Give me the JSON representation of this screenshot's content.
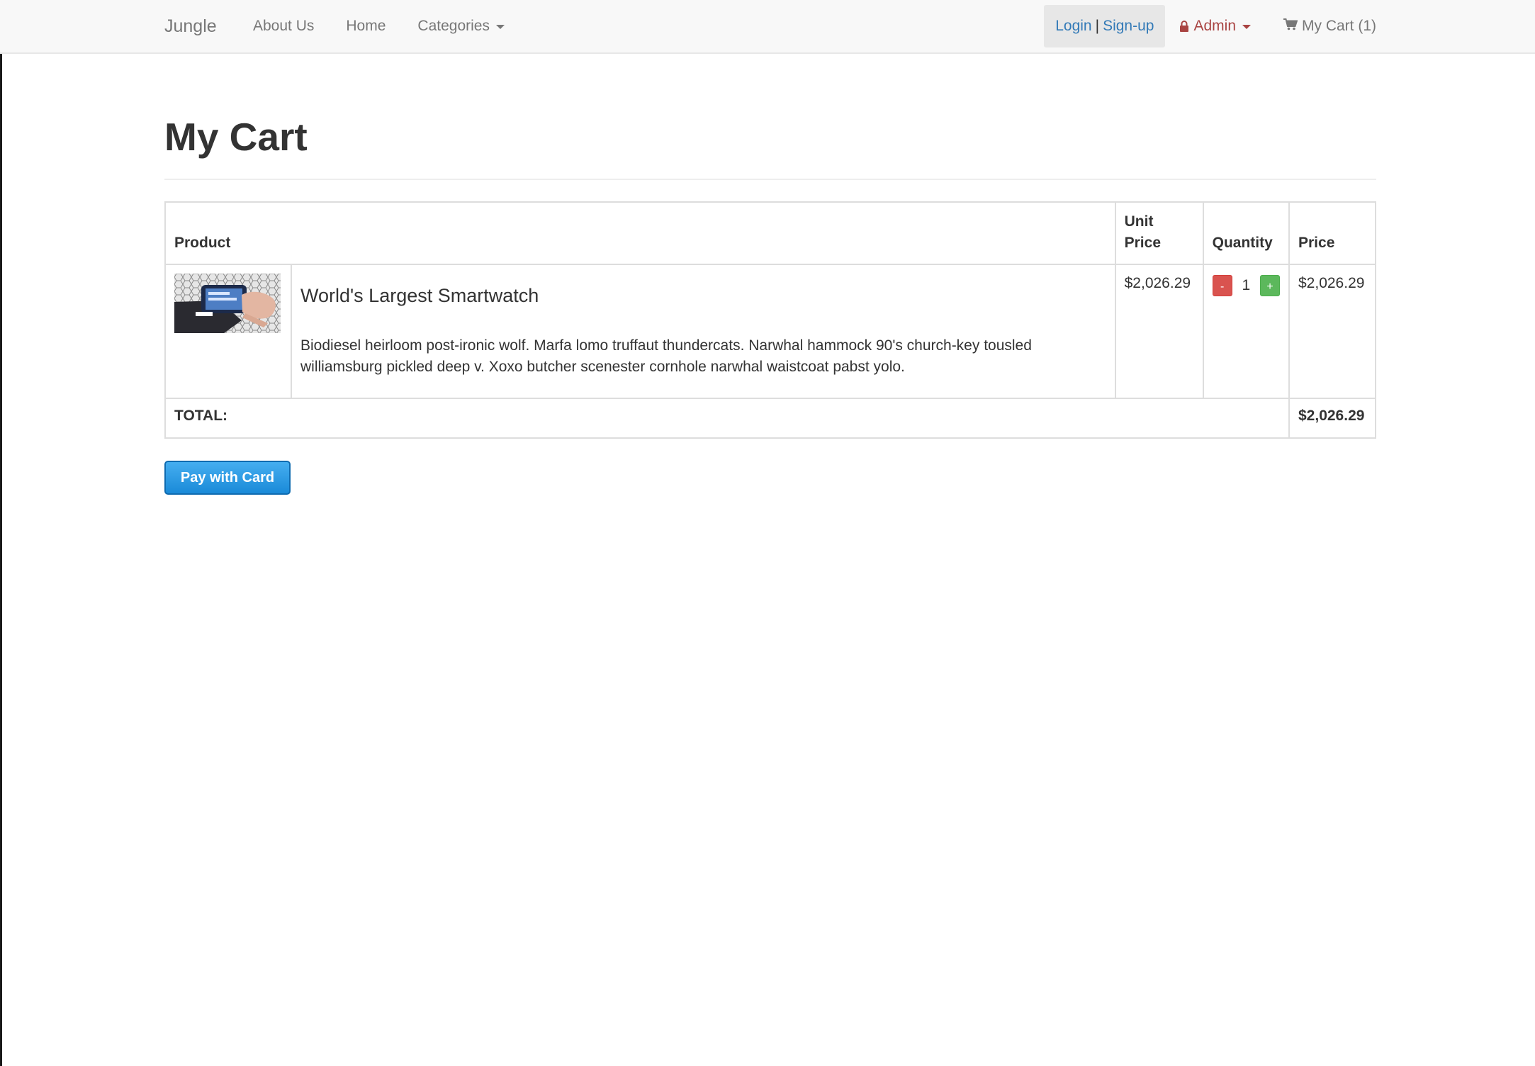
{
  "nav": {
    "brand": "Jungle",
    "links": [
      "About Us",
      "Home",
      "Categories"
    ],
    "login": "Login",
    "separator": "|",
    "signup": "Sign-up",
    "admin": "Admin",
    "cart": "My Cart (1)"
  },
  "page": {
    "title": "My Cart"
  },
  "table": {
    "headers": {
      "product": "Product",
      "unit_price_line1": "Unit",
      "unit_price_line2": "Price",
      "quantity": "Quantity",
      "price": "Price"
    },
    "rows": [
      {
        "name": "World's Largest Smartwatch",
        "description": "Biodiesel heirloom post-ironic wolf. Marfa lomo truffaut thundercats. Narwhal hammock 90's church-key tousled williamsburg pickled deep v. Xoxo butcher scenester cornhole narwhal waistcoat pabst yolo.",
        "unit_price": "$2,026.29",
        "quantity": "1",
        "minus": "-",
        "plus": "+",
        "price": "$2,026.29"
      }
    ],
    "total_label": "TOTAL:",
    "total_value": "$2,026.29"
  },
  "pay_button": "Pay with Card",
  "colors": {
    "link": "#337ab7",
    "admin": "#a94442",
    "minus": "#d9534f",
    "plus": "#5cb85c",
    "pay": "#1a8ad8"
  },
  "icons": {
    "admin": "lock-icon",
    "cart": "shopping-cart-icon",
    "dropdown": "caret-down-icon"
  }
}
